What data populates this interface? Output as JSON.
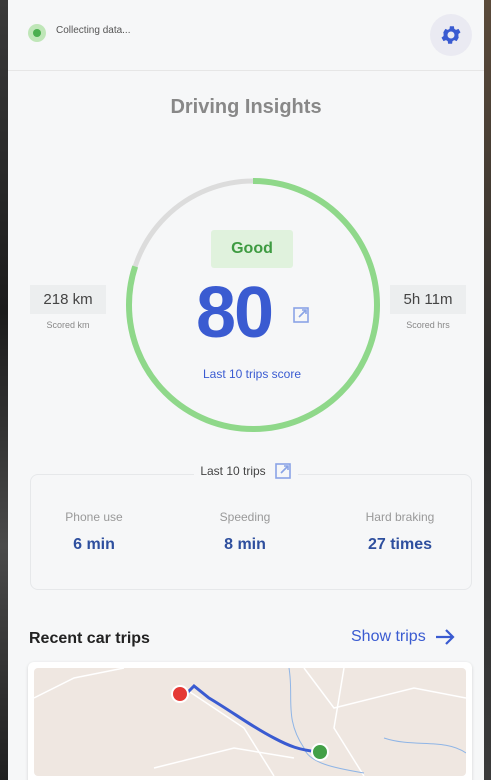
{
  "status": {
    "collecting_text": "Collecting data..."
  },
  "header": {
    "title": "Driving Insights"
  },
  "score_section": {
    "distance_value": "218 km",
    "distance_label": "Scored km",
    "time_value": "5h 11m",
    "time_label": "Scored hrs",
    "badge": "Good",
    "score": "80",
    "score_caption": "Last 10 trips score",
    "gauge_fraction": 0.8
  },
  "trips_summary": {
    "title": "Last 10 trips",
    "metrics": [
      {
        "name": "Phone use",
        "value": "6 min"
      },
      {
        "name": "Speeding",
        "value": "8 min"
      },
      {
        "name": "Hard braking",
        "value": "27 times"
      }
    ]
  },
  "recent": {
    "title": "Recent car trips",
    "show_trips": "Show trips"
  },
  "colors": {
    "accent": "#3a5bd1",
    "gauge_good": "#8fd88a",
    "gauge_track": "#dcdcdc",
    "start_marker": "#e53935",
    "end_marker": "#43a047"
  },
  "icons": {
    "settings": "gear-icon",
    "edit": "external-link-icon",
    "arrow": "arrow-right-icon"
  }
}
